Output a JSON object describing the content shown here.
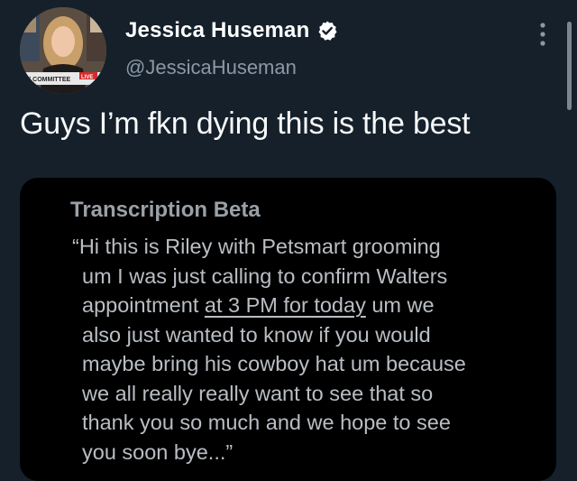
{
  "author": {
    "display_name": "Jessica Huseman",
    "handle": "@JessicaHuseman",
    "avatar_banner_text": "EY COMMITTEE",
    "avatar_live_text": "LIVE"
  },
  "tweet": {
    "text": "Guys I’m fkn dying this is the best"
  },
  "transcription_card": {
    "title": "Transcription Beta",
    "lines": {
      "l1": "“Hi this is Riley with Petsmart grooming",
      "l2": "um I was just calling to confirm Walters",
      "l3_start": "appointment ",
      "l3_link": "at 3 PM for today",
      "l3_end": " um we",
      "l4": "also just wanted to know if you would",
      "l5": "maybe bring his cowboy hat um because",
      "l6": "we all really really want to see that so",
      "l7": "thank you so much and we hope to see",
      "l8": "you soon bye...”"
    }
  },
  "colors": {
    "background": "#15202b",
    "card": "#000000",
    "verified": "#ffffff"
  },
  "icons": {
    "verified": "verified-badge-icon",
    "more": "more-options-icon"
  }
}
